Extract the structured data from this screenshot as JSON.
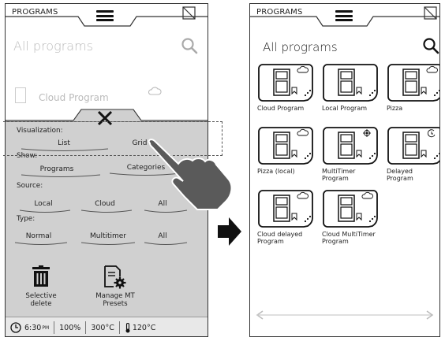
{
  "left_screen": {
    "header": {
      "title": "PROGRAMS"
    },
    "heading": "All programs",
    "faded_item": {
      "label": "Cloud Program"
    },
    "visualization": {
      "label": "Visualization:",
      "options": [
        "List",
        "Grid"
      ]
    },
    "show": {
      "label": "Show:",
      "options": [
        "Programs",
        "Categories"
      ]
    },
    "source": {
      "label": "Source:",
      "options": [
        "Local",
        "Cloud",
        "All"
      ]
    },
    "type": {
      "label": "Type:",
      "options": [
        "Normal",
        "Multitimer",
        "All"
      ]
    },
    "actions": {
      "delete": "Selective delete",
      "presets": "Manage MT Presets"
    },
    "status": {
      "time": "6:30",
      "time_suffix": "PM",
      "percent": "100%",
      "temp1": "300°C",
      "temp2": "120°C"
    }
  },
  "right_screen": {
    "header": {
      "title": "PROGRAMS"
    },
    "heading": "All programs",
    "programs": [
      {
        "label": "Cloud Program",
        "badge": "cloud-icon"
      },
      {
        "label": "Local Program",
        "badge": "none"
      },
      {
        "label": "Pizza",
        "badge": "cloud-icon"
      },
      {
        "label": "Pizza (local)",
        "badge": "cloud-icon"
      },
      {
        "label": "MultiTimer Program",
        "badge": "multitimer-icon"
      },
      {
        "label": "Delayed Program",
        "badge": "delay-icon"
      },
      {
        "label": "Cloud delayed Program",
        "badge": "cloud-icon"
      },
      {
        "label": "Cloud MultiTimer Program",
        "badge": "cloud-icon"
      }
    ]
  },
  "colors": {
    "drawer_bg": "#d0d0d0",
    "line": "#333333",
    "faded_text": "#bbbbbb"
  }
}
